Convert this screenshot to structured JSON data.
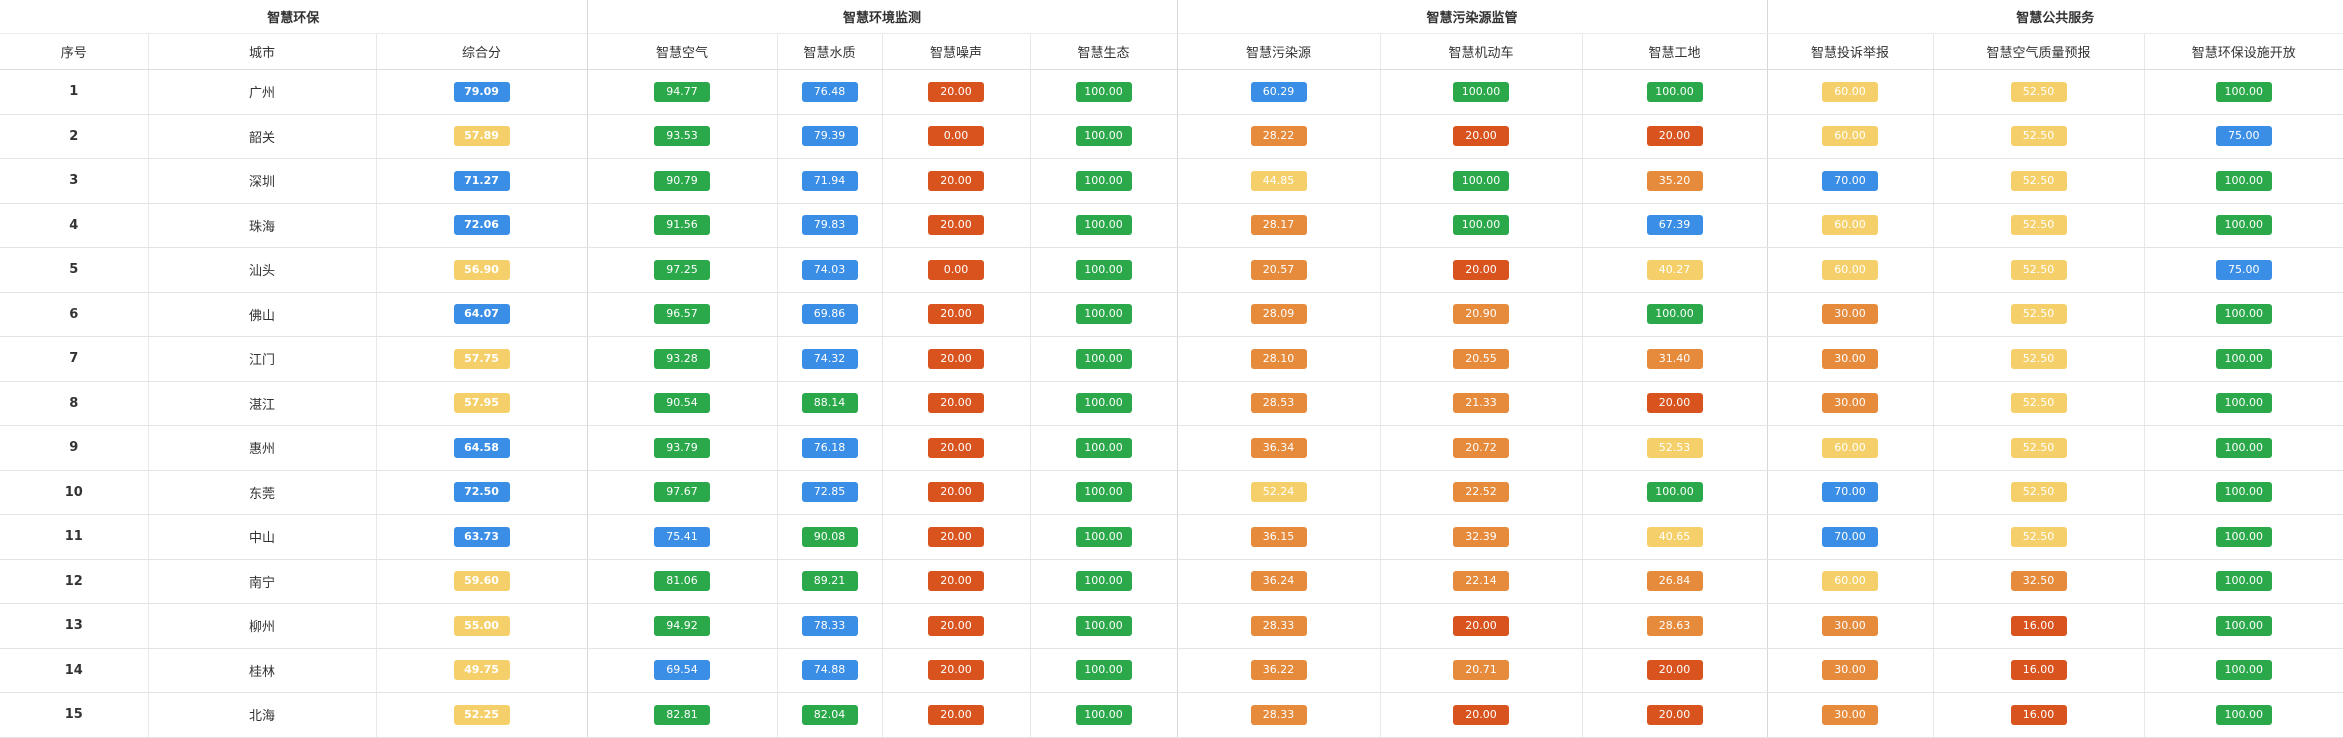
{
  "header": {
    "groups": [
      {
        "label": "智慧环保",
        "span": 3
      },
      {
        "label": "智慧环境监测",
        "span": 4
      },
      {
        "label": "智慧污染源监管",
        "span": 3
      },
      {
        "label": "智慧公共服务",
        "span": 3
      }
    ],
    "columns": [
      "序号",
      "城市",
      "综合分",
      "智慧空气",
      "智慧水质",
      "智慧噪声",
      "智慧生态",
      "智慧污染源",
      "智慧机动车",
      "智慧工地",
      "智慧投诉举报",
      "智慧空气质量预报",
      "智慧环保设施开放"
    ]
  },
  "colors": {
    "green": "#2aa84a",
    "blue": "#3a8ee6",
    "yellow": "#f5d06a",
    "orange": "#e68a3c",
    "red": "#d9531e"
  },
  "rows": [
    {
      "index": "1",
      "city": "广州",
      "scores": [
        [
          "79.09",
          "blue"
        ],
        [
          "94.77",
          "green"
        ],
        [
          "76.48",
          "blue"
        ],
        [
          "20.00",
          "red"
        ],
        [
          "100.00",
          "green"
        ],
        [
          "60.29",
          "blue"
        ],
        [
          "100.00",
          "green"
        ],
        [
          "100.00",
          "green"
        ],
        [
          "60.00",
          "yellow"
        ],
        [
          "52.50",
          "yellow"
        ],
        [
          "100.00",
          "green"
        ]
      ]
    },
    {
      "index": "2",
      "city": "韶关",
      "scores": [
        [
          "57.89",
          "yellow"
        ],
        [
          "93.53",
          "green"
        ],
        [
          "79.39",
          "blue"
        ],
        [
          "0.00",
          "red"
        ],
        [
          "100.00",
          "green"
        ],
        [
          "28.22",
          "orange"
        ],
        [
          "20.00",
          "red"
        ],
        [
          "20.00",
          "red"
        ],
        [
          "60.00",
          "yellow"
        ],
        [
          "52.50",
          "yellow"
        ],
        [
          "75.00",
          "blue"
        ]
      ]
    },
    {
      "index": "3",
      "city": "深圳",
      "scores": [
        [
          "71.27",
          "blue"
        ],
        [
          "90.79",
          "green"
        ],
        [
          "71.94",
          "blue"
        ],
        [
          "20.00",
          "red"
        ],
        [
          "100.00",
          "green"
        ],
        [
          "44.85",
          "yellow"
        ],
        [
          "100.00",
          "green"
        ],
        [
          "35.20",
          "orange"
        ],
        [
          "70.00",
          "blue"
        ],
        [
          "52.50",
          "yellow"
        ],
        [
          "100.00",
          "green"
        ]
      ]
    },
    {
      "index": "4",
      "city": "珠海",
      "scores": [
        [
          "72.06",
          "blue"
        ],
        [
          "91.56",
          "green"
        ],
        [
          "79.83",
          "blue"
        ],
        [
          "20.00",
          "red"
        ],
        [
          "100.00",
          "green"
        ],
        [
          "28.17",
          "orange"
        ],
        [
          "100.00",
          "green"
        ],
        [
          "67.39",
          "blue"
        ],
        [
          "60.00",
          "yellow"
        ],
        [
          "52.50",
          "yellow"
        ],
        [
          "100.00",
          "green"
        ]
      ]
    },
    {
      "index": "5",
      "city": "汕头",
      "scores": [
        [
          "56.90",
          "yellow"
        ],
        [
          "97.25",
          "green"
        ],
        [
          "74.03",
          "blue"
        ],
        [
          "0.00",
          "red"
        ],
        [
          "100.00",
          "green"
        ],
        [
          "20.57",
          "orange"
        ],
        [
          "20.00",
          "red"
        ],
        [
          "40.27",
          "yellow"
        ],
        [
          "60.00",
          "yellow"
        ],
        [
          "52.50",
          "yellow"
        ],
        [
          "75.00",
          "blue"
        ]
      ]
    },
    {
      "index": "6",
      "city": "佛山",
      "scores": [
        [
          "64.07",
          "blue"
        ],
        [
          "96.57",
          "green"
        ],
        [
          "69.86",
          "blue"
        ],
        [
          "20.00",
          "red"
        ],
        [
          "100.00",
          "green"
        ],
        [
          "28.09",
          "orange"
        ],
        [
          "20.90",
          "orange"
        ],
        [
          "100.00",
          "green"
        ],
        [
          "30.00",
          "orange"
        ],
        [
          "52.50",
          "yellow"
        ],
        [
          "100.00",
          "green"
        ]
      ]
    },
    {
      "index": "7",
      "city": "江门",
      "scores": [
        [
          "57.75",
          "yellow"
        ],
        [
          "93.28",
          "green"
        ],
        [
          "74.32",
          "blue"
        ],
        [
          "20.00",
          "red"
        ],
        [
          "100.00",
          "green"
        ],
        [
          "28.10",
          "orange"
        ],
        [
          "20.55",
          "orange"
        ],
        [
          "31.40",
          "orange"
        ],
        [
          "30.00",
          "orange"
        ],
        [
          "52.50",
          "yellow"
        ],
        [
          "100.00",
          "green"
        ]
      ]
    },
    {
      "index": "8",
      "city": "湛江",
      "scores": [
        [
          "57.95",
          "yellow"
        ],
        [
          "90.54",
          "green"
        ],
        [
          "88.14",
          "green"
        ],
        [
          "20.00",
          "red"
        ],
        [
          "100.00",
          "green"
        ],
        [
          "28.53",
          "orange"
        ],
        [
          "21.33",
          "orange"
        ],
        [
          "20.00",
          "red"
        ],
        [
          "30.00",
          "orange"
        ],
        [
          "52.50",
          "yellow"
        ],
        [
          "100.00",
          "green"
        ]
      ]
    },
    {
      "index": "9",
      "city": "惠州",
      "scores": [
        [
          "64.58",
          "blue"
        ],
        [
          "93.79",
          "green"
        ],
        [
          "76.18",
          "blue"
        ],
        [
          "20.00",
          "red"
        ],
        [
          "100.00",
          "green"
        ],
        [
          "36.34",
          "orange"
        ],
        [
          "20.72",
          "orange"
        ],
        [
          "52.53",
          "yellow"
        ],
        [
          "60.00",
          "yellow"
        ],
        [
          "52.50",
          "yellow"
        ],
        [
          "100.00",
          "green"
        ]
      ]
    },
    {
      "index": "10",
      "city": "东莞",
      "scores": [
        [
          "72.50",
          "blue"
        ],
        [
          "97.67",
          "green"
        ],
        [
          "72.85",
          "blue"
        ],
        [
          "20.00",
          "red"
        ],
        [
          "100.00",
          "green"
        ],
        [
          "52.24",
          "yellow"
        ],
        [
          "22.52",
          "orange"
        ],
        [
          "100.00",
          "green"
        ],
        [
          "70.00",
          "blue"
        ],
        [
          "52.50",
          "yellow"
        ],
        [
          "100.00",
          "green"
        ]
      ]
    },
    {
      "index": "11",
      "city": "中山",
      "scores": [
        [
          "63.73",
          "blue"
        ],
        [
          "75.41",
          "blue"
        ],
        [
          "90.08",
          "green"
        ],
        [
          "20.00",
          "red"
        ],
        [
          "100.00",
          "green"
        ],
        [
          "36.15",
          "orange"
        ],
        [
          "32.39",
          "orange"
        ],
        [
          "40.65",
          "yellow"
        ],
        [
          "70.00",
          "blue"
        ],
        [
          "52.50",
          "yellow"
        ],
        [
          "100.00",
          "green"
        ]
      ]
    },
    {
      "index": "12",
      "city": "南宁",
      "scores": [
        [
          "59.60",
          "yellow"
        ],
        [
          "81.06",
          "green"
        ],
        [
          "89.21",
          "green"
        ],
        [
          "20.00",
          "red"
        ],
        [
          "100.00",
          "green"
        ],
        [
          "36.24",
          "orange"
        ],
        [
          "22.14",
          "orange"
        ],
        [
          "26.84",
          "orange"
        ],
        [
          "60.00",
          "yellow"
        ],
        [
          "32.50",
          "orange"
        ],
        [
          "100.00",
          "green"
        ]
      ]
    },
    {
      "index": "13",
      "city": "柳州",
      "scores": [
        [
          "55.00",
          "yellow"
        ],
        [
          "94.92",
          "green"
        ],
        [
          "78.33",
          "blue"
        ],
        [
          "20.00",
          "red"
        ],
        [
          "100.00",
          "green"
        ],
        [
          "28.33",
          "orange"
        ],
        [
          "20.00",
          "red"
        ],
        [
          "28.63",
          "orange"
        ],
        [
          "30.00",
          "orange"
        ],
        [
          "16.00",
          "red"
        ],
        [
          "100.00",
          "green"
        ]
      ]
    },
    {
      "index": "14",
      "city": "桂林",
      "scores": [
        [
          "49.75",
          "yellow"
        ],
        [
          "69.54",
          "blue"
        ],
        [
          "74.88",
          "blue"
        ],
        [
          "20.00",
          "red"
        ],
        [
          "100.00",
          "green"
        ],
        [
          "36.22",
          "orange"
        ],
        [
          "20.71",
          "orange"
        ],
        [
          "20.00",
          "red"
        ],
        [
          "30.00",
          "orange"
        ],
        [
          "16.00",
          "red"
        ],
        [
          "100.00",
          "green"
        ]
      ]
    },
    {
      "index": "15",
      "city": "北海",
      "scores": [
        [
          "52.25",
          "yellow"
        ],
        [
          "82.81",
          "green"
        ],
        [
          "82.04",
          "green"
        ],
        [
          "20.00",
          "red"
        ],
        [
          "100.00",
          "green"
        ],
        [
          "28.33",
          "orange"
        ],
        [
          "20.00",
          "red"
        ],
        [
          "20.00",
          "red"
        ],
        [
          "30.00",
          "orange"
        ],
        [
          "16.00",
          "red"
        ],
        [
          "100.00",
          "green"
        ]
      ]
    }
  ]
}
